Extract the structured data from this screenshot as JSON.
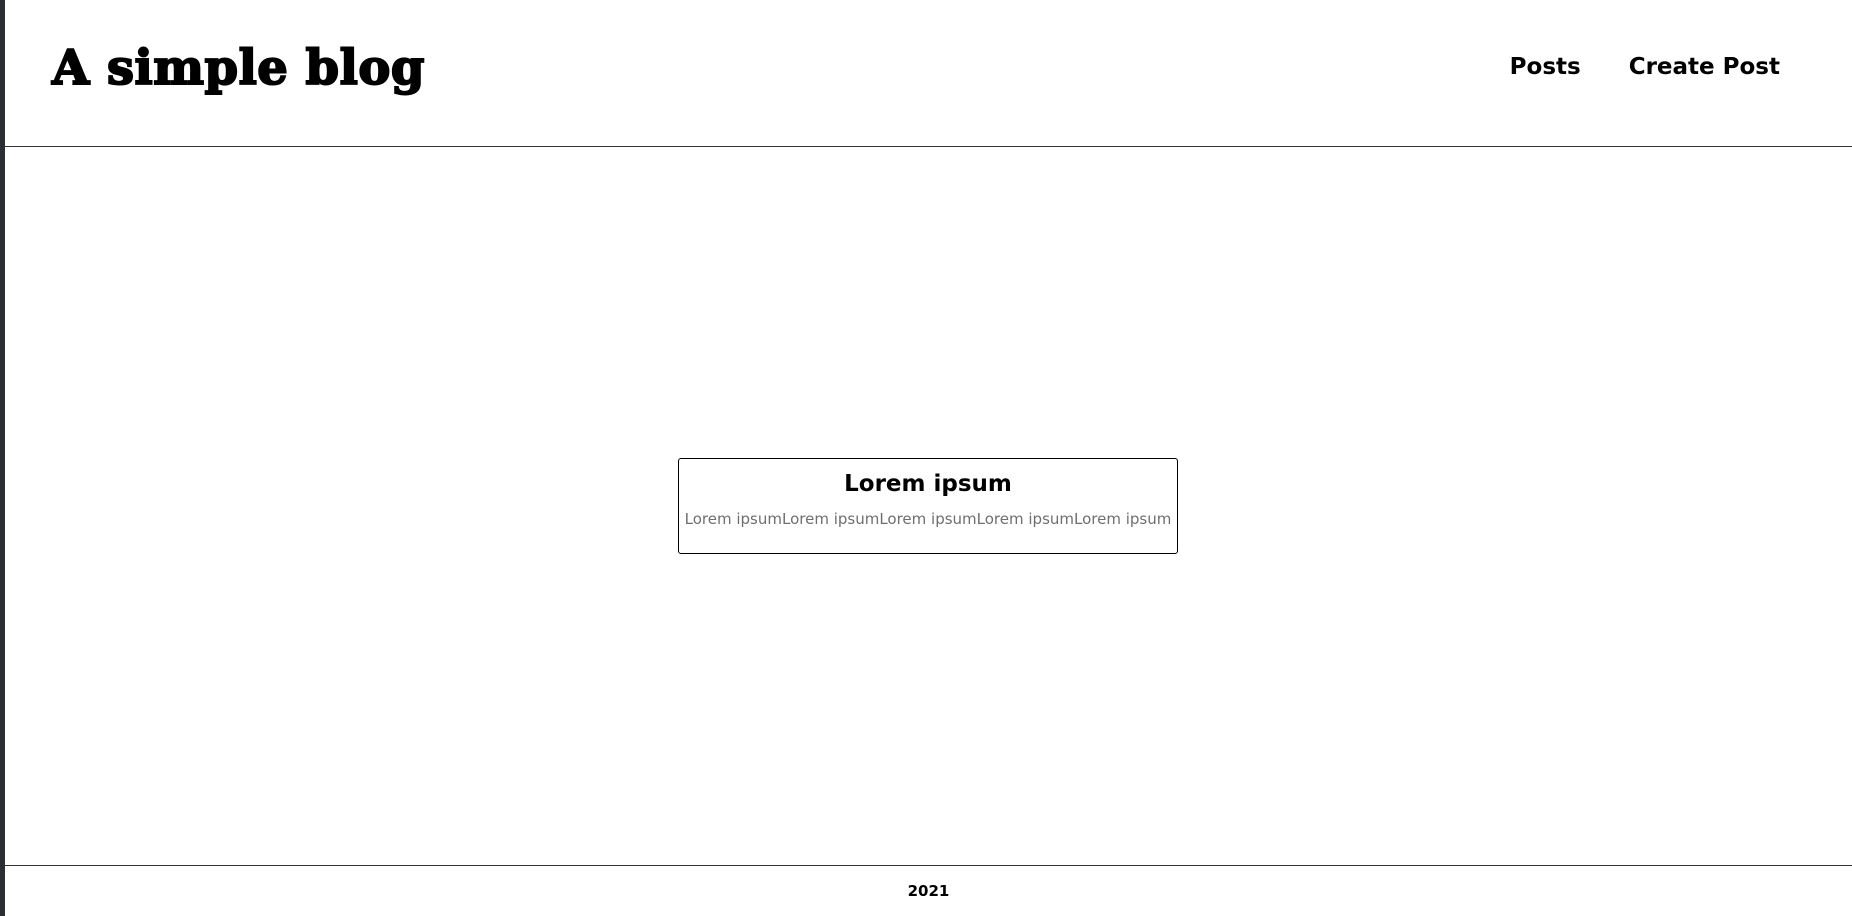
{
  "header": {
    "site_title": "A simple blog",
    "nav": [
      {
        "label": "Posts"
      },
      {
        "label": "Create Post"
      }
    ]
  },
  "posts": [
    {
      "title": "Lorem ipsum",
      "excerpt": "Lorem ipsumLorem ipsumLorem ipsumLorem ipsumLorem ipsum"
    }
  ],
  "footer": {
    "text": "2021"
  },
  "colors": {
    "background": "#ffffff",
    "text": "#000000",
    "muted_text": "#6f6f6f",
    "border": "#333333"
  }
}
